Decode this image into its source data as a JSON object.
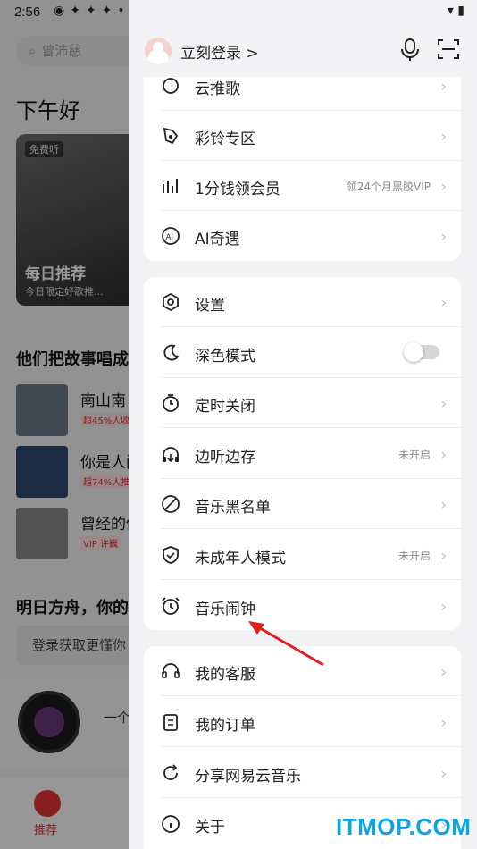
{
  "status_bar": {
    "time": "2:56"
  },
  "background": {
    "search_placeholder": "曾沛慈",
    "greeting": "下午好",
    "card": {
      "badge": "免费听",
      "title": "每日推荐",
      "subtitle": "今日限定好歌推..."
    },
    "section1": "他们把故事唱成",
    "songs": [
      {
        "name": "南山南",
        "tag": "超45%人收"
      },
      {
        "name": "你是人间",
        "tag": "超74%人推"
      },
      {
        "name": "曾经的你",
        "tag": "VIP 许巍"
      }
    ],
    "section2": "明日方舟，你的",
    "login_hint": "登录获取更懂你",
    "player_text": "一个",
    "nav": {
      "recommend": "推荐"
    }
  },
  "drawer": {
    "login_label": "立刻登录 >",
    "group1": [
      {
        "label": "云推歌",
        "icon": "cloud-song-icon"
      },
      {
        "label": "彩铃专区",
        "icon": "ringtone-icon"
      },
      {
        "label": "1分钱领会员",
        "note": "领24个月黑胶VIP",
        "icon": "vip-bars-icon"
      },
      {
        "label": "AI奇遇",
        "icon": "ai-icon"
      }
    ],
    "group2": [
      {
        "label": "设置",
        "icon": "hexagon-settings-icon"
      },
      {
        "label": "深色模式",
        "icon": "moon-icon",
        "toggle": false
      },
      {
        "label": "定时关闭",
        "icon": "timer-icon"
      },
      {
        "label": "边听边存",
        "note": "未开启",
        "icon": "headphone-download-icon"
      },
      {
        "label": "音乐黑名单",
        "icon": "block-icon"
      },
      {
        "label": "未成年人模式",
        "note": "未开启",
        "icon": "shield-check-icon"
      },
      {
        "label": "音乐闹钟",
        "icon": "alarm-clock-icon"
      }
    ],
    "group3": [
      {
        "label": "我的客服",
        "icon": "headset-icon"
      },
      {
        "label": "我的订单",
        "icon": "order-icon"
      },
      {
        "label": "分享网易云音乐",
        "icon": "share-icon"
      },
      {
        "label": "关于",
        "icon": "info-icon"
      }
    ]
  },
  "watermark": "ITMOP.COM",
  "colors": {
    "accent_red": "#e53232",
    "annotation_arrow": "#e02020",
    "watermark": "#0aa6e6"
  }
}
